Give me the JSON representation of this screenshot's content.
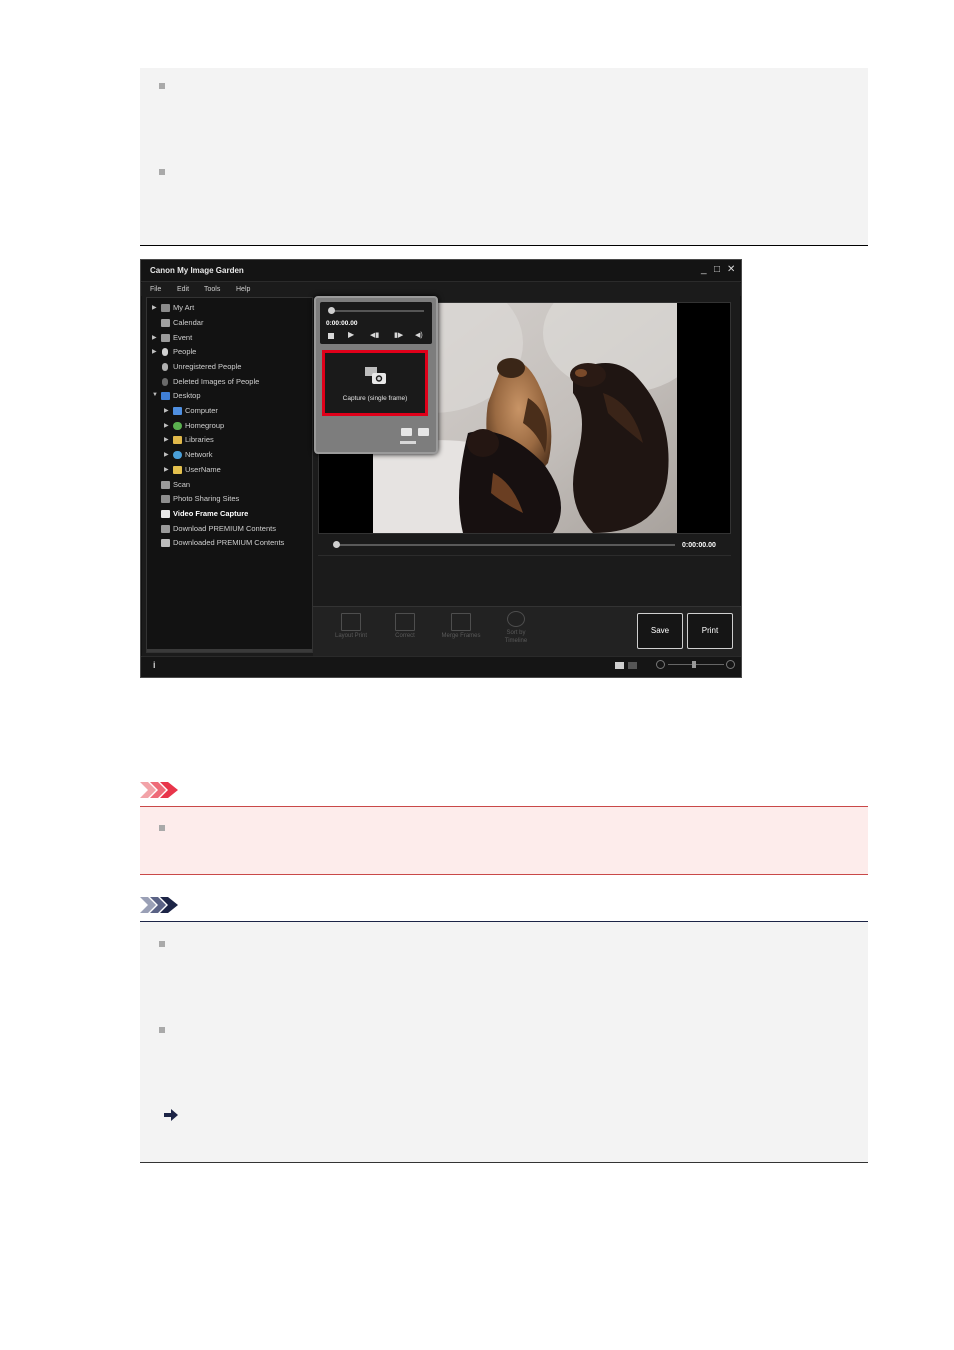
{
  "app": {
    "title": "Canon My Image Garden",
    "window_controls": [
      "_",
      "□",
      "✕"
    ],
    "menu": [
      "File",
      "Edit",
      "Tools",
      "Help"
    ],
    "sidebar_items": [
      {
        "label": "My Art",
        "expandable": true,
        "level": 0
      },
      {
        "label": "Calendar",
        "expandable": false,
        "level": 0
      },
      {
        "label": "Event",
        "expandable": true,
        "level": 0
      },
      {
        "label": "People",
        "expandable": true,
        "level": 0
      },
      {
        "label": "Unregistered People",
        "expandable": false,
        "level": 0
      },
      {
        "label": "Deleted Images of People",
        "expandable": false,
        "level": 0
      },
      {
        "label": "Desktop",
        "expandable": true,
        "expanded": true,
        "level": 0
      },
      {
        "label": "Computer",
        "expandable": true,
        "level": 1
      },
      {
        "label": "Homegroup",
        "expandable": true,
        "level": 1
      },
      {
        "label": "Libraries",
        "expandable": true,
        "level": 1
      },
      {
        "label": "Network",
        "expandable": true,
        "level": 1
      },
      {
        "label": "UserName",
        "expandable": true,
        "level": 1
      },
      {
        "label": "Scan",
        "expandable": false,
        "level": 0
      },
      {
        "label": "Photo Sharing Sites",
        "expandable": false,
        "level": 0
      },
      {
        "label": "Video Frame Capture",
        "expandable": false,
        "level": 0,
        "selected": true
      },
      {
        "label": "Download PREMIUM Contents",
        "expandable": false,
        "level": 0
      },
      {
        "label": "Downloaded PREMIUM Contents",
        "expandable": false,
        "level": 0
      }
    ],
    "player": {
      "time": "0:00:00.00",
      "capture_label": "Capture (single frame)"
    },
    "timeline_time": "0:00:00.00",
    "tools": [
      {
        "label": "Layout Print"
      },
      {
        "label": "Correct"
      },
      {
        "label": "Merge Frames"
      },
      {
        "label": "Sort by Timeline"
      }
    ],
    "save_label": "Save",
    "print_label": "Print",
    "info_icon": "i"
  },
  "colors": {
    "highlight_red": "#e0001a",
    "important_bg": "#fdeceb",
    "important_rule": "#c94848",
    "note_icon": "#1c2446",
    "important_icon": "#e8354a"
  }
}
